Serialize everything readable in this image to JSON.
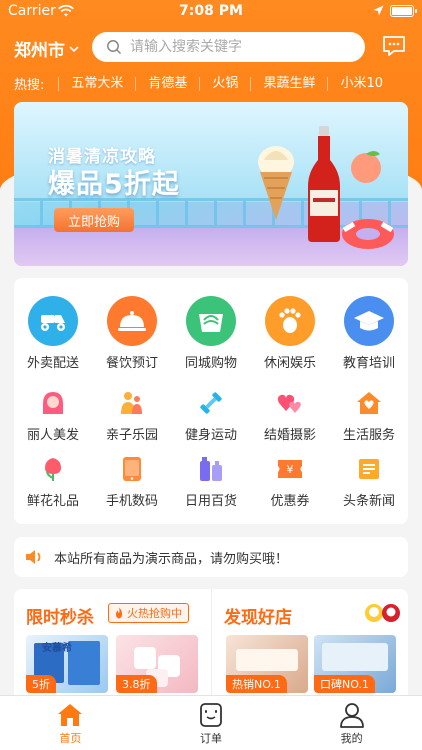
{
  "status_bar": {
    "carrier": "Carrier",
    "time": "7:08 PM"
  },
  "header": {
    "city": "郑州市",
    "search_placeholder": "请输入搜索关键字",
    "hot_label": "热搜:",
    "hot_keywords": [
      "五常大米",
      "肯德基",
      "火锅",
      "果蔬生鲜",
      "小米10"
    ]
  },
  "banner": {
    "line1": "消暑清凉攻略",
    "line2": "爆品5折起",
    "cta": "立即抢购"
  },
  "categories_main": [
    {
      "label": "外卖配送",
      "icon": "scooter-icon",
      "color": "#2fb0e8"
    },
    {
      "label": "餐饮预订",
      "icon": "cloche-icon",
      "color": "#ff7a2f"
    },
    {
      "label": "同城购物",
      "icon": "shopping-bag-icon",
      "color": "#3cc37a"
    },
    {
      "label": "休闲娱乐",
      "icon": "footprint-icon",
      "color": "#ff9d2a"
    },
    {
      "label": "教育培训",
      "icon": "graduation-cap-icon",
      "color": "#4a8ff0"
    }
  ],
  "categories_small": [
    {
      "label": "丽人美发",
      "icon": "woman-icon",
      "color": "#ff5b7f"
    },
    {
      "label": "亲子乐园",
      "icon": "family-icon",
      "color": "#ffae38"
    },
    {
      "label": "健身运动",
      "icon": "dumbbell-icon",
      "color": "#28b3e6"
    },
    {
      "label": "结婚摄影",
      "icon": "hearts-icon",
      "color": "#ff4f73"
    },
    {
      "label": "生活服务",
      "icon": "house-icon",
      "color": "#ff8a2a"
    },
    {
      "label": "鲜花礼品",
      "icon": "flower-icon",
      "color": "#ff5b6a"
    },
    {
      "label": "手机数码",
      "icon": "phone-icon",
      "color": "#ff8a3a"
    },
    {
      "label": "日用百货",
      "icon": "bottles-icon",
      "color": "#7a6cf0"
    },
    {
      "label": "优惠券",
      "icon": "coupon-icon",
      "color": "#ff7a2f"
    },
    {
      "label": "头条新闻",
      "icon": "news-icon",
      "color": "#ffa928"
    }
  ],
  "notice": {
    "text": "本站所有商品为演示商品，请勿购买哦！"
  },
  "promo": {
    "flash_title": "限时秒杀",
    "flash_tag": "火热抢购中",
    "flash_items": [
      {
        "badge": "5折",
        "brand": "安慕希"
      },
      {
        "badge": "3.8折"
      }
    ],
    "shops_title": "发现好店",
    "shop_items": [
      {
        "badge": "热销NO.1"
      },
      {
        "badge": "口碑NO.1"
      }
    ]
  },
  "tabs": [
    {
      "label": "首页",
      "icon": "home-icon",
      "active": true
    },
    {
      "label": "订单",
      "icon": "order-icon",
      "active": false
    },
    {
      "label": "我的",
      "icon": "user-icon",
      "active": false
    }
  ],
  "colors": {
    "brand": "#ff7a10",
    "accent": "#ff6a12",
    "background": "#f4f4f4"
  }
}
